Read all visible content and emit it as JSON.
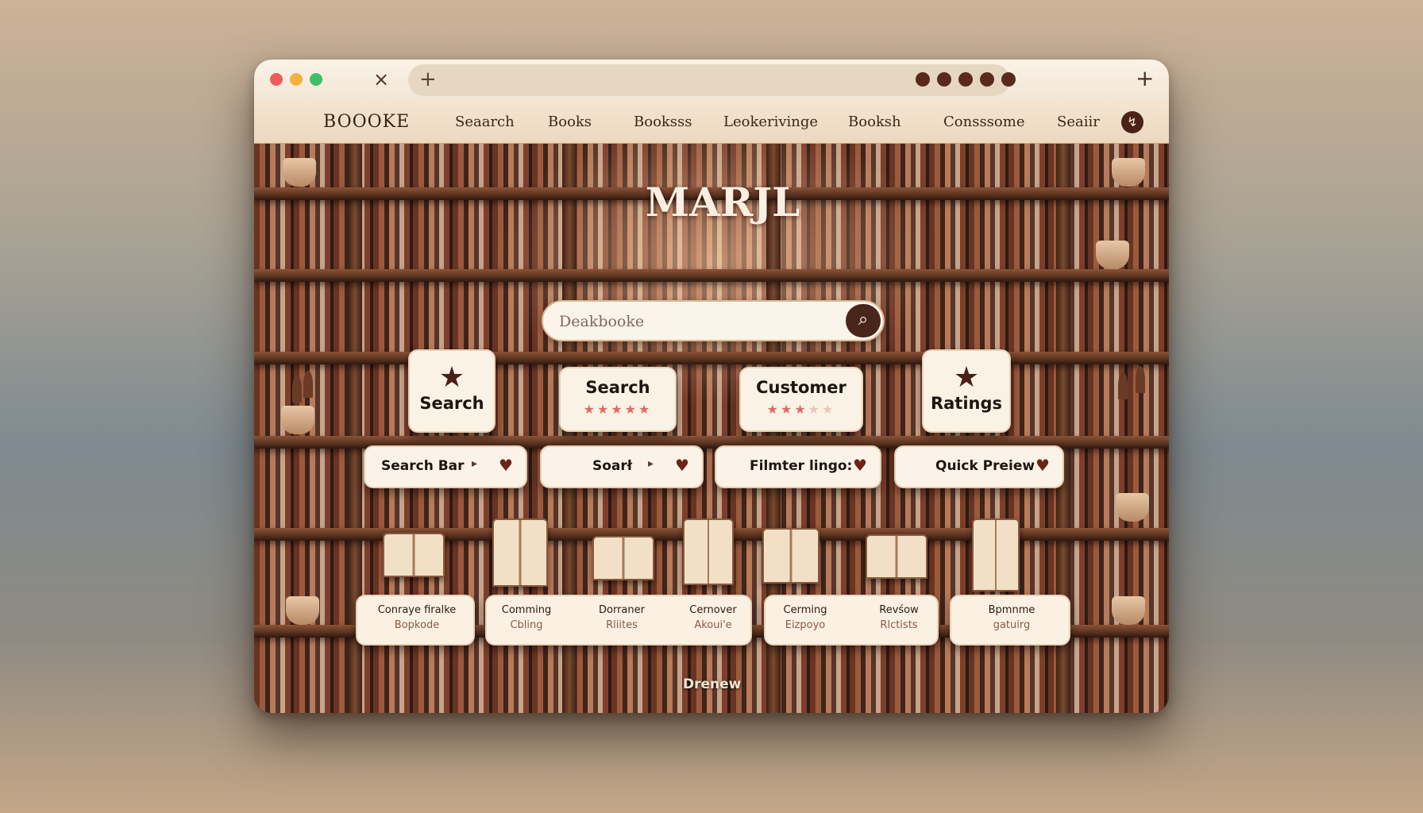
{
  "browser": {
    "close_icon": "×",
    "new_tab_icon": "+",
    "add_icon": "+"
  },
  "nav": {
    "brand": "BOOOKE",
    "links": [
      "Seaarch",
      "Books",
      "Booksss",
      "Leokerivinge",
      "Booksh",
      "Consssome",
      "Seaiir"
    ],
    "icon_glyph": "↯"
  },
  "hero": {
    "title": "MARJL"
  },
  "search": {
    "placeholder": "Deakbooke",
    "button_icon": "⌕"
  },
  "cards": [
    {
      "icon": "★",
      "title": "Search"
    },
    {
      "title": "Search",
      "rating": 5
    },
    {
      "title": "Customer",
      "rating": 3
    },
    {
      "icon": "★",
      "title": "Ratings"
    }
  ],
  "features": [
    {
      "label": "Search Bar",
      "arrow": "▸",
      "heart": "♥"
    },
    {
      "label": "Soarł",
      "arrow": "▸",
      "heart": "♥"
    },
    {
      "label": "Filmter lingo:",
      "heart": "♥"
    },
    {
      "label": "Quick Preiew",
      "heart": "♥"
    }
  ],
  "info_cards": [
    {
      "cols": [
        {
          "l1": "Conraye firalke",
          "l2": "Bopkode"
        }
      ]
    },
    {
      "cols": [
        {
          "l1": "Comming",
          "l2": "Cbling"
        },
        {
          "l1": "Dorraner",
          "l2": "Rliites"
        },
        {
          "l1": "Cernover",
          "l2": "Akoui'e"
        }
      ]
    },
    {
      "cols": [
        {
          "l1": "Cerming",
          "l2": "Eizpoyo"
        },
        {
          "l1": "Revśow",
          "l2": "Rlctists"
        }
      ]
    },
    {
      "cols": [
        {
          "l1": "Bpmnme",
          "l2": "gatuirg"
        }
      ]
    }
  ],
  "footer": {
    "label": "Drenew"
  },
  "colors": {
    "accent_dark": "#4a2519",
    "star_active": "#e06a62",
    "card_bg": "#fbf2e6"
  }
}
